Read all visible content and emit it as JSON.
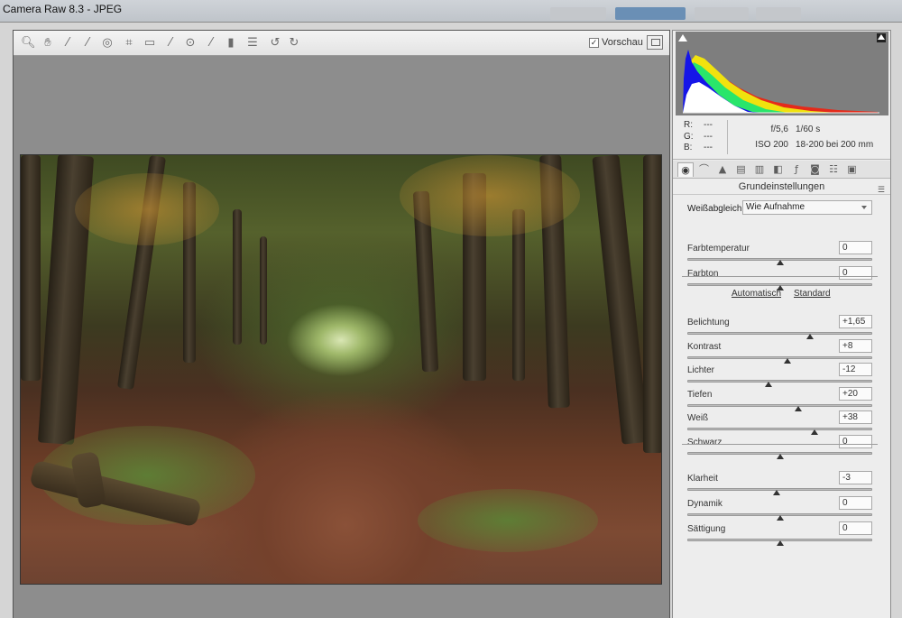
{
  "window": {
    "title": "Camera Raw 8.3 - JPEG"
  },
  "toolbar": {
    "tools": [
      {
        "icon": "zoom-icon",
        "glyph": "🔍︎"
      },
      {
        "icon": "hand-icon",
        "glyph": "✋︎"
      },
      {
        "icon": "white-balance-icon",
        "glyph": "⁄"
      },
      {
        "icon": "color-sampler-icon",
        "glyph": "⁄"
      },
      {
        "icon": "targeted-adjustment-icon",
        "glyph": "◎"
      },
      {
        "icon": "crop-icon",
        "glyph": "⌗"
      },
      {
        "icon": "straighten-icon",
        "glyph": "▭"
      },
      {
        "icon": "spot-removal-icon",
        "glyph": "⁄"
      },
      {
        "icon": "red-eye-icon",
        "glyph": "⊙"
      },
      {
        "icon": "adjustment-brush-icon",
        "glyph": "⁄"
      },
      {
        "icon": "graduated-filter-icon",
        "glyph": "▮"
      },
      {
        "icon": "preferences-icon",
        "glyph": "☰"
      },
      {
        "icon": "rotate-left-icon",
        "glyph": "↺"
      },
      {
        "icon": "rotate-right-icon",
        "glyph": "↻"
      }
    ],
    "preview_label": "Vorschau",
    "preview_checked": true
  },
  "info": {
    "r_label": "R:",
    "r_value": "---",
    "g_label": "G:",
    "g_value": "---",
    "b_label": "B:",
    "b_value": "---",
    "aperture": "f/5,6",
    "shutter": "1/60 s",
    "iso": "ISO 200",
    "lens": "18-200 bei 200 mm"
  },
  "panel": {
    "section_title": "Grundeinstellungen",
    "tabs": [
      "basic-icon",
      "tone-curve-icon",
      "detail-icon",
      "hsl-icon",
      "split-toning-icon",
      "lens-corrections-icon",
      "effects-icon",
      "camera-calibration-icon",
      "presets-icon",
      "snapshots-icon"
    ],
    "white_balance_label": "Weißabgleich:",
    "white_balance_value": "Wie Aufnahme",
    "auto_label": "Automatisch",
    "default_label": "Standard",
    "sliders": [
      {
        "id": "farbtemperatur",
        "label": "Farbtemperatur",
        "value": "0",
        "pos": 0.5
      },
      {
        "id": "farbton",
        "label": "Farbton",
        "value": "0",
        "pos": 0.5
      },
      {
        "id": "belichtung",
        "label": "Belichtung",
        "value": "+1,65",
        "pos": 0.665
      },
      {
        "id": "kontrast",
        "label": "Kontrast",
        "value": "+8",
        "pos": 0.54
      },
      {
        "id": "lichter",
        "label": "Lichter",
        "value": "-12",
        "pos": 0.44
      },
      {
        "id": "tiefen",
        "label": "Tiefen",
        "value": "+20",
        "pos": 0.6
      },
      {
        "id": "weiss",
        "label": "Weiß",
        "value": "+38",
        "pos": 0.69
      },
      {
        "id": "schwarz",
        "label": "Schwarz",
        "value": "0",
        "pos": 0.5
      },
      {
        "id": "klarheit",
        "label": "Klarheit",
        "value": "-3",
        "pos": 0.485
      },
      {
        "id": "dynamik",
        "label": "Dynamik",
        "value": "0",
        "pos": 0.5
      },
      {
        "id": "saettigung",
        "label": "Sättigung",
        "value": "0",
        "pos": 0.5
      }
    ]
  }
}
